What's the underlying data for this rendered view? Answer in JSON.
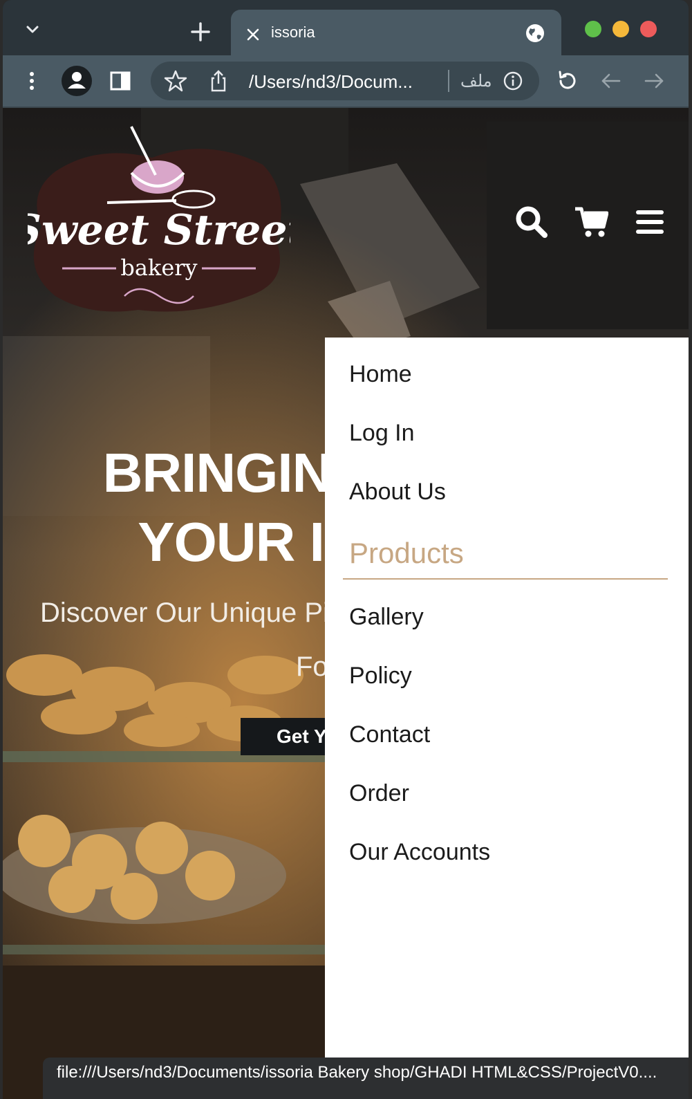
{
  "browser": {
    "tab": {
      "title": "issoria"
    },
    "address_bar": {
      "url": "/Users/nd3/Docum...",
      "file_label": "ملف"
    },
    "window_controls": {
      "colors": [
        "#5fc04a",
        "#f5b83a",
        "#ed5b5b"
      ]
    },
    "status_url": "file:///Users/nd3/Documents/issoria Bakery shop/GHADI HTML&CSS/ProjectV0...."
  },
  "site": {
    "logo": {
      "line1": "Sweet Street",
      "line2": "bakery"
    },
    "hero": {
      "title_line1": "BRINGIN",
      "title_line2": "YOUR I",
      "subtitle_line1": "Discover Our Unique Pi",
      "subtitle_line2": "Fo",
      "cta_label": "Get Y"
    },
    "menu": {
      "items": [
        {
          "label": "Home",
          "active": false
        },
        {
          "label": "Log In",
          "active": false
        },
        {
          "label": "About Us",
          "active": false
        },
        {
          "label": "Products",
          "active": true
        },
        {
          "label": "Gallery",
          "active": false
        },
        {
          "label": "Policy",
          "active": false
        },
        {
          "label": "Contact",
          "active": false
        },
        {
          "label": "Order",
          "active": false
        },
        {
          "label": "Our Accounts",
          "active": false
        }
      ],
      "active_color": "#c7a783"
    },
    "colors": {
      "brand_brown": "#3a1d1a",
      "brand_pink": "#d9a6c9",
      "accent_tan": "#c7a783"
    }
  }
}
